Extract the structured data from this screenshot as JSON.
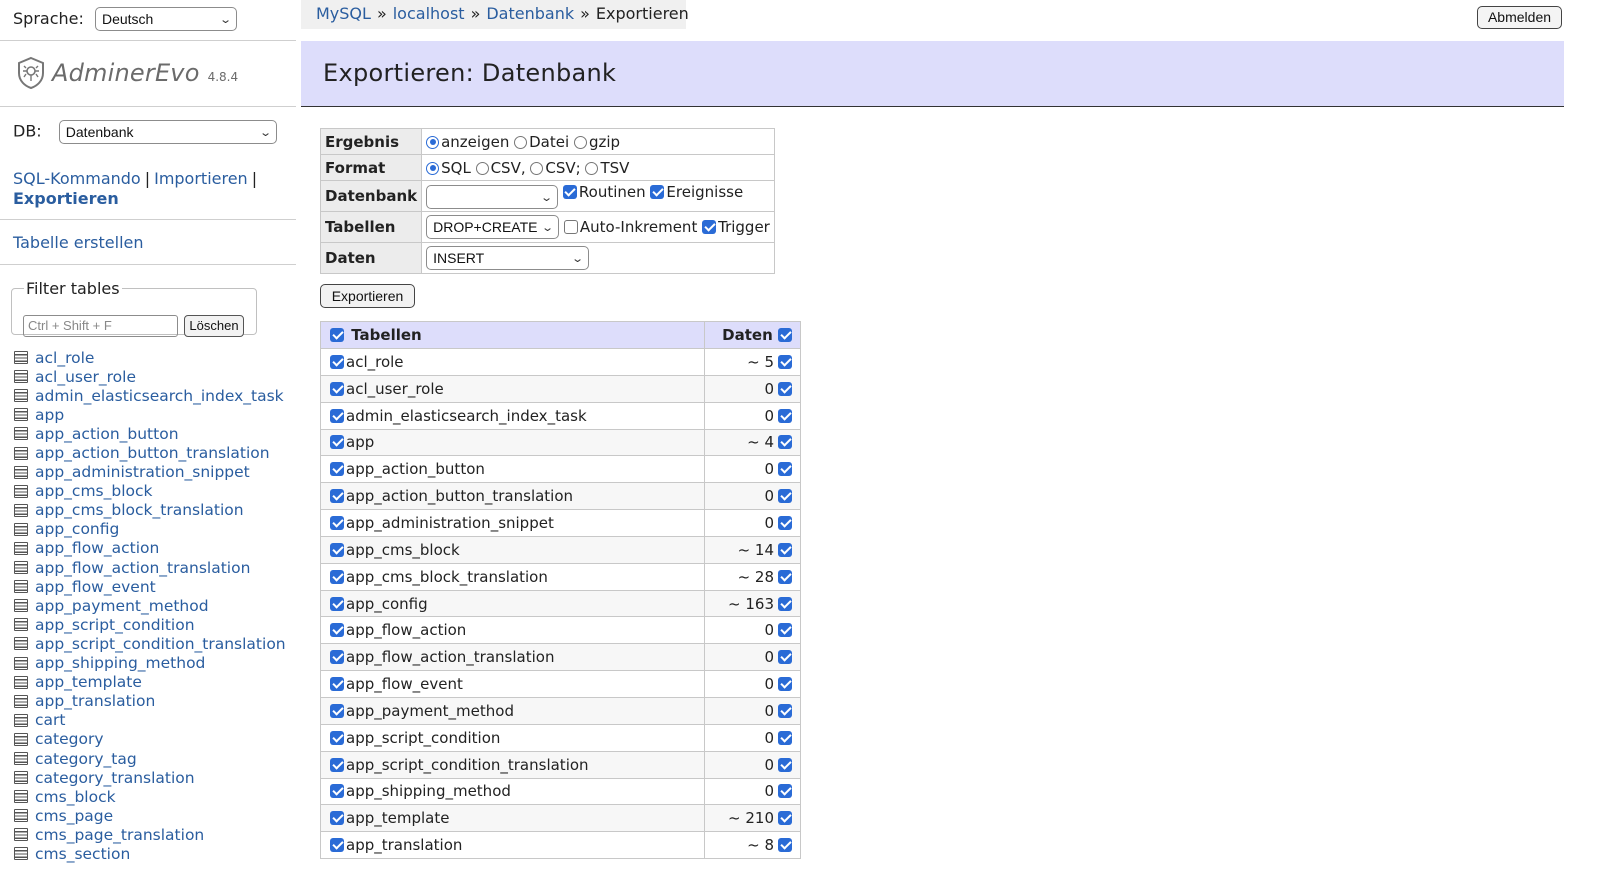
{
  "sidebar": {
    "language_label": "Sprache:",
    "language_value": "Deutsch",
    "brand_name": "AdminerEvo",
    "brand_version": "4.8.4",
    "db_label": "DB:",
    "db_value": "Datenbank",
    "links": {
      "sql": "SQL-Kommando",
      "import": "Importieren",
      "export": "Exportieren",
      "separator": "|"
    },
    "create_table": "Tabelle erstellen",
    "filter": {
      "legend": "Filter tables",
      "placeholder": "Ctrl + Shift + F",
      "clear_label": "Löschen"
    },
    "tables": [
      "acl_role",
      "acl_user_role",
      "admin_elasticsearch_index_task",
      "app",
      "app_action_button",
      "app_action_button_translation",
      "app_administration_snippet",
      "app_cms_block",
      "app_cms_block_translation",
      "app_config",
      "app_flow_action",
      "app_flow_action_translation",
      "app_flow_event",
      "app_payment_method",
      "app_script_condition",
      "app_script_condition_translation",
      "app_shipping_method",
      "app_template",
      "app_translation",
      "cart",
      "category",
      "category_tag",
      "category_translation",
      "cms_block",
      "cms_page",
      "cms_page_translation",
      "cms_section"
    ]
  },
  "breadcrumb": {
    "items": [
      "MySQL",
      "localhost",
      "Datenbank"
    ],
    "current": "Exportieren",
    "separator": "»"
  },
  "logout_label": "Abmelden",
  "header_title": "Exportieren: Datenbank",
  "options": {
    "ergebnis": {
      "label": "Ergebnis",
      "choices": [
        {
          "label": "anzeigen",
          "selected": true
        },
        {
          "label": "Datei",
          "selected": false
        },
        {
          "label": "gzip",
          "selected": false
        }
      ]
    },
    "format": {
      "label": "Format",
      "choices": [
        {
          "label": "SQL",
          "selected": true
        },
        {
          "label": "CSV,",
          "selected": false
        },
        {
          "label": "CSV;",
          "selected": false
        },
        {
          "label": "TSV",
          "selected": false
        }
      ]
    },
    "datenbank": {
      "label": "Datenbank",
      "select_value": "",
      "routinen": {
        "label": "Routinen",
        "checked": true
      },
      "ereignisse": {
        "label": "Ereignisse",
        "checked": true
      }
    },
    "tabellen": {
      "label": "Tabellen",
      "select_value": "DROP+CREATE",
      "auto_inkrement": {
        "label": "Auto-Inkrement",
        "checked": false
      },
      "trigger": {
        "label": "Trigger",
        "checked": true
      }
    },
    "daten": {
      "label": "Daten",
      "select_value": "INSERT"
    }
  },
  "export_button": "Exportieren",
  "table_list": {
    "header_tables": "Tabellen",
    "header_data": "Daten",
    "rows": [
      {
        "name": "acl_role",
        "count": "~ 5"
      },
      {
        "name": "acl_user_role",
        "count": "0"
      },
      {
        "name": "admin_elasticsearch_index_task",
        "count": "0"
      },
      {
        "name": "app",
        "count": "~ 4"
      },
      {
        "name": "app_action_button",
        "count": "0"
      },
      {
        "name": "app_action_button_translation",
        "count": "0"
      },
      {
        "name": "app_administration_snippet",
        "count": "0"
      },
      {
        "name": "app_cms_block",
        "count": "~ 14"
      },
      {
        "name": "app_cms_block_translation",
        "count": "~ 28"
      },
      {
        "name": "app_config",
        "count": "~ 163"
      },
      {
        "name": "app_flow_action",
        "count": "0"
      },
      {
        "name": "app_flow_action_translation",
        "count": "0"
      },
      {
        "name": "app_flow_event",
        "count": "0"
      },
      {
        "name": "app_payment_method",
        "count": "0"
      },
      {
        "name": "app_script_condition",
        "count": "0"
      },
      {
        "name": "app_script_condition_translation",
        "count": "0"
      },
      {
        "name": "app_shipping_method",
        "count": "0"
      },
      {
        "name": "app_template",
        "count": "~ 210"
      },
      {
        "name": "app_translation",
        "count": "~ 8"
      }
    ]
  },
  "colors": {
    "link": "#2a5d9f",
    "header_bg": "#ddddfb",
    "checkbox": "#2a6bd6"
  }
}
